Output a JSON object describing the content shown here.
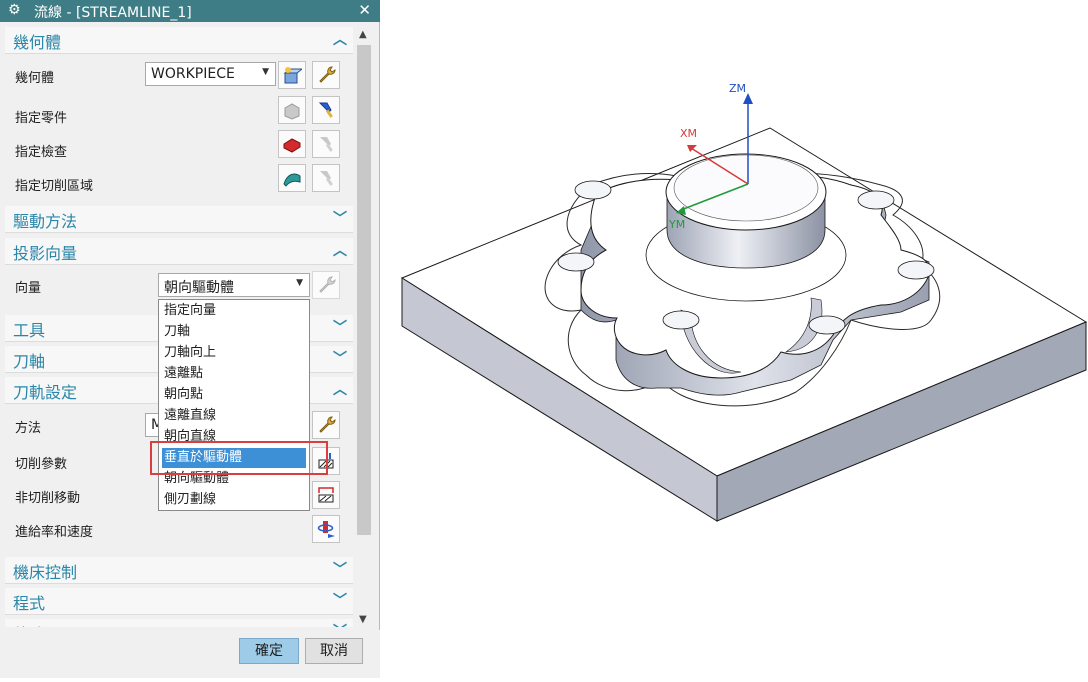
{
  "dialog": {
    "title": "流線 - [STREAMLINE_1]",
    "sections": {
      "geometry": {
        "label": "幾何體",
        "expanded": true
      },
      "drive_method": {
        "label": "驅動方法",
        "expanded": false
      },
      "projection_vector": {
        "label": "投影向量",
        "expanded": true
      },
      "tool": {
        "label": "工具",
        "expanded": false
      },
      "tool_axis": {
        "label": "刀軸",
        "expanded": false
      },
      "path_settings": {
        "label": "刀軌設定",
        "expanded": true
      },
      "machine_control": {
        "label": "機床控制",
        "expanded": false
      },
      "program": {
        "label": "程式",
        "expanded": false
      },
      "description": {
        "label": "敘述",
        "expanded": false
      }
    },
    "geometry_rows": {
      "geometry_label": "幾何體",
      "geometry_value": "WORKPIECE",
      "specify_part": "指定零件",
      "specify_check": "指定檢查",
      "specify_cut_area": "指定切削區域"
    },
    "projection": {
      "vector_label": "向量",
      "vector_value": "朝向驅動體",
      "options": [
        "指定向量",
        "刀軸",
        "刀軸向上",
        "遠離點",
        "朝向點",
        "遠離直線",
        "朝向直線",
        "垂直於驅動體",
        "朝向驅動體",
        "側刃劃線"
      ],
      "selected_option": "垂直於驅動體"
    },
    "path_rows": {
      "method": "方法",
      "method_value_partial": "M",
      "cutting_params": "切削參數",
      "non_cutting": "非切削移動",
      "feeds_speeds": "進給率和速度"
    },
    "buttons": {
      "ok": "確定",
      "cancel": "取消"
    }
  },
  "viewport": {
    "axes": {
      "zm": "ZM",
      "xm": "XM",
      "ym": "YM"
    },
    "colors": {
      "z_axis": "#1f4fc4",
      "x_axis": "#d63a3a",
      "y_axis": "#1f9a3a"
    }
  },
  "colors": {
    "title_bar": "#3e7d86",
    "section_text": "#2a86a8",
    "selected_option": "#3d8fd6",
    "highlight_box": "#d93f3f",
    "ok_button": "#9ecbe8"
  }
}
